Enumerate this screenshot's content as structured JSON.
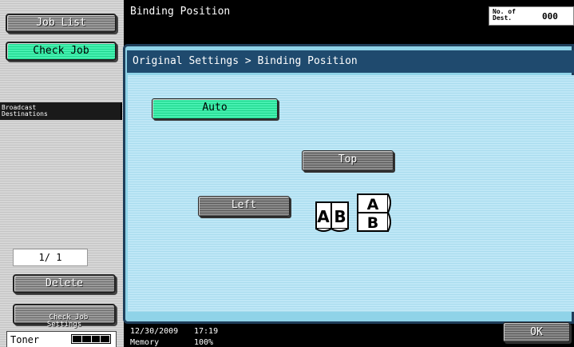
{
  "sidebar": {
    "job_list_label": "Job List",
    "check_job_label": "Check Job",
    "broadcast_label": "Broadcast\nDestinations",
    "page_indicator": "1/ 1",
    "delete_label": "Delete",
    "check_job_settings_label": "Check Job\nSettings",
    "toner_label": "Toner",
    "toner_level": 1.0
  },
  "header": {
    "title": "Binding Position",
    "dest_label": "No. of\nDest.",
    "dest_count": "000"
  },
  "panel": {
    "breadcrumb": "Original Settings > Binding Position",
    "auto_label": "Auto",
    "top_label": "Top",
    "left_label": "Left",
    "icon_left_letters": [
      "A",
      "B"
    ],
    "icon_top_letters": [
      "A",
      "B"
    ],
    "selected_option": "Auto"
  },
  "status": {
    "date": "12/30/2009",
    "time": "17:19",
    "memory_label": "Memory",
    "memory_value": "100%"
  },
  "footer": {
    "ok_label": "OK"
  },
  "colors": {
    "selected_button": "#2fe4a0",
    "panel_bg": "#a9dcee",
    "header_bar": "#1f4a6e"
  }
}
